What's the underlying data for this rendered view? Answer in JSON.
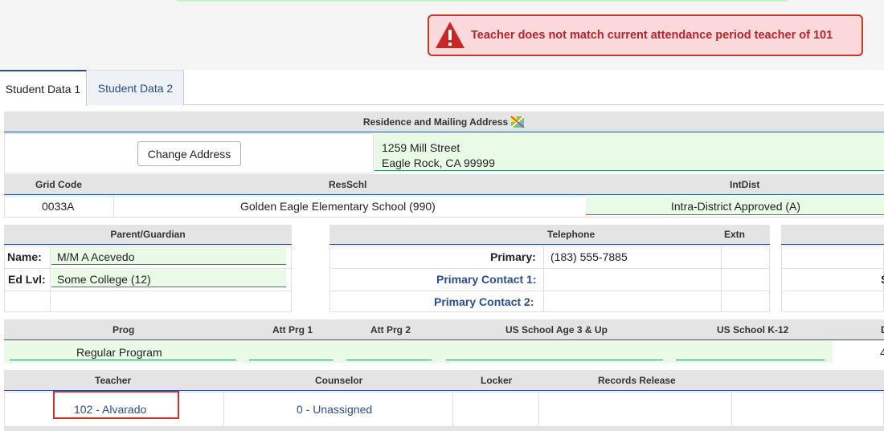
{
  "alert": {
    "message": "Teacher does not match current attendance period teacher of 101"
  },
  "tabs": [
    {
      "label": "Student Data 1"
    },
    {
      "label": "Student Data 2"
    }
  ],
  "address": {
    "header": "Residence and Mailing Address",
    "change_button": "Change Address",
    "line1": "1259 Mill Street",
    "line2": "Eagle Rock, CA 99999"
  },
  "grid": {
    "headers": {
      "grid_code": "Grid Code",
      "resschl": "ResSchl",
      "intdist": "IntDist"
    },
    "grid_code": "0033A",
    "resschl": "Golden Eagle Elementary School (990)",
    "intdist": "Intra-District Approved (A)"
  },
  "parent": {
    "header": "Parent/Guardian",
    "name_label": "Name:",
    "name_value": "M/M A Acevedo",
    "edlvl_label": "Ed Lvl:",
    "edlvl_value": "Some College (12)"
  },
  "telephone": {
    "header": "Telephone",
    "extn_header": "Extn",
    "primary_label": "Primary:",
    "primary_value": "(183) 555-7885",
    "contact1_label": "Primary Contact 1:",
    "contact2_label": "Primary Contact 2:",
    "right_edge_char": "S"
  },
  "programs": {
    "headers": {
      "prog": "Prog",
      "att1": "Att Prg 1",
      "att2": "Att Prg 2",
      "us_age": "US School Age 3 & Up",
      "us_k12": "US School K-12",
      "edge": "D"
    },
    "prog_value": "Regular Program",
    "edge_value": "4"
  },
  "staff": {
    "headers": {
      "teacher": "Teacher",
      "counselor": "Counselor",
      "locker": "Locker",
      "records": "Records Release"
    },
    "teacher_value": "102 - Alvarado",
    "counselor_value": "0 - Unassigned"
  }
}
